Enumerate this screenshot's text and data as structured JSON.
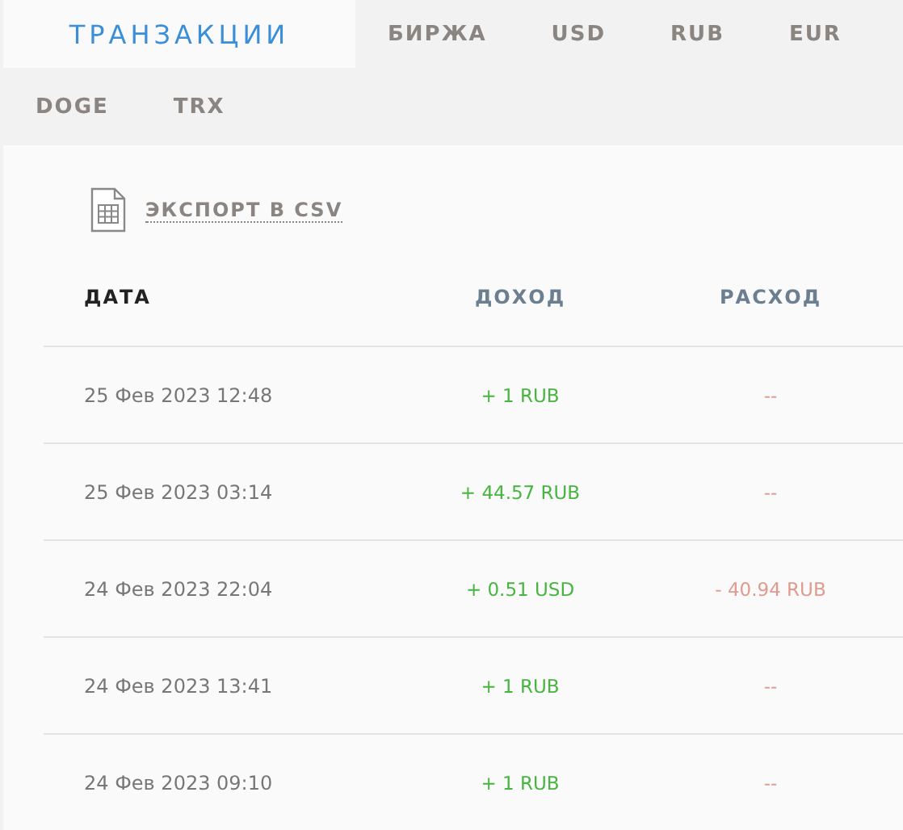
{
  "tabs": [
    {
      "label": "ТРАНЗАКЦИИ",
      "selected": true
    },
    {
      "label": "БИРЖА",
      "selected": false
    },
    {
      "label": "USD",
      "selected": false
    },
    {
      "label": "RUB",
      "selected": false
    },
    {
      "label": "EUR",
      "selected": false
    },
    {
      "label": "DOGE",
      "selected": false
    },
    {
      "label": "TRX",
      "selected": false
    }
  ],
  "export": {
    "label": "ЭКСПОРТ В CSV"
  },
  "table": {
    "columns": [
      "ДАТА",
      "ДОХОД",
      "РАСХОД"
    ],
    "rows": [
      {
        "date": "25 Фев 2023 12:48",
        "income": "+ 1 RUB",
        "expense": "--"
      },
      {
        "date": "25 Фев 2023 03:14",
        "income": "+ 44.57 RUB",
        "expense": "--"
      },
      {
        "date": "24 Фев 2023 22:04",
        "income": "+ 0.51 USD",
        "expense": "- 40.94 RUB"
      },
      {
        "date": "24 Фев 2023 13:41",
        "income": "+ 1 RUB",
        "expense": "--"
      },
      {
        "date": "24 Фев 2023 09:10",
        "income": "+ 1 RUB",
        "expense": "--"
      }
    ]
  }
}
